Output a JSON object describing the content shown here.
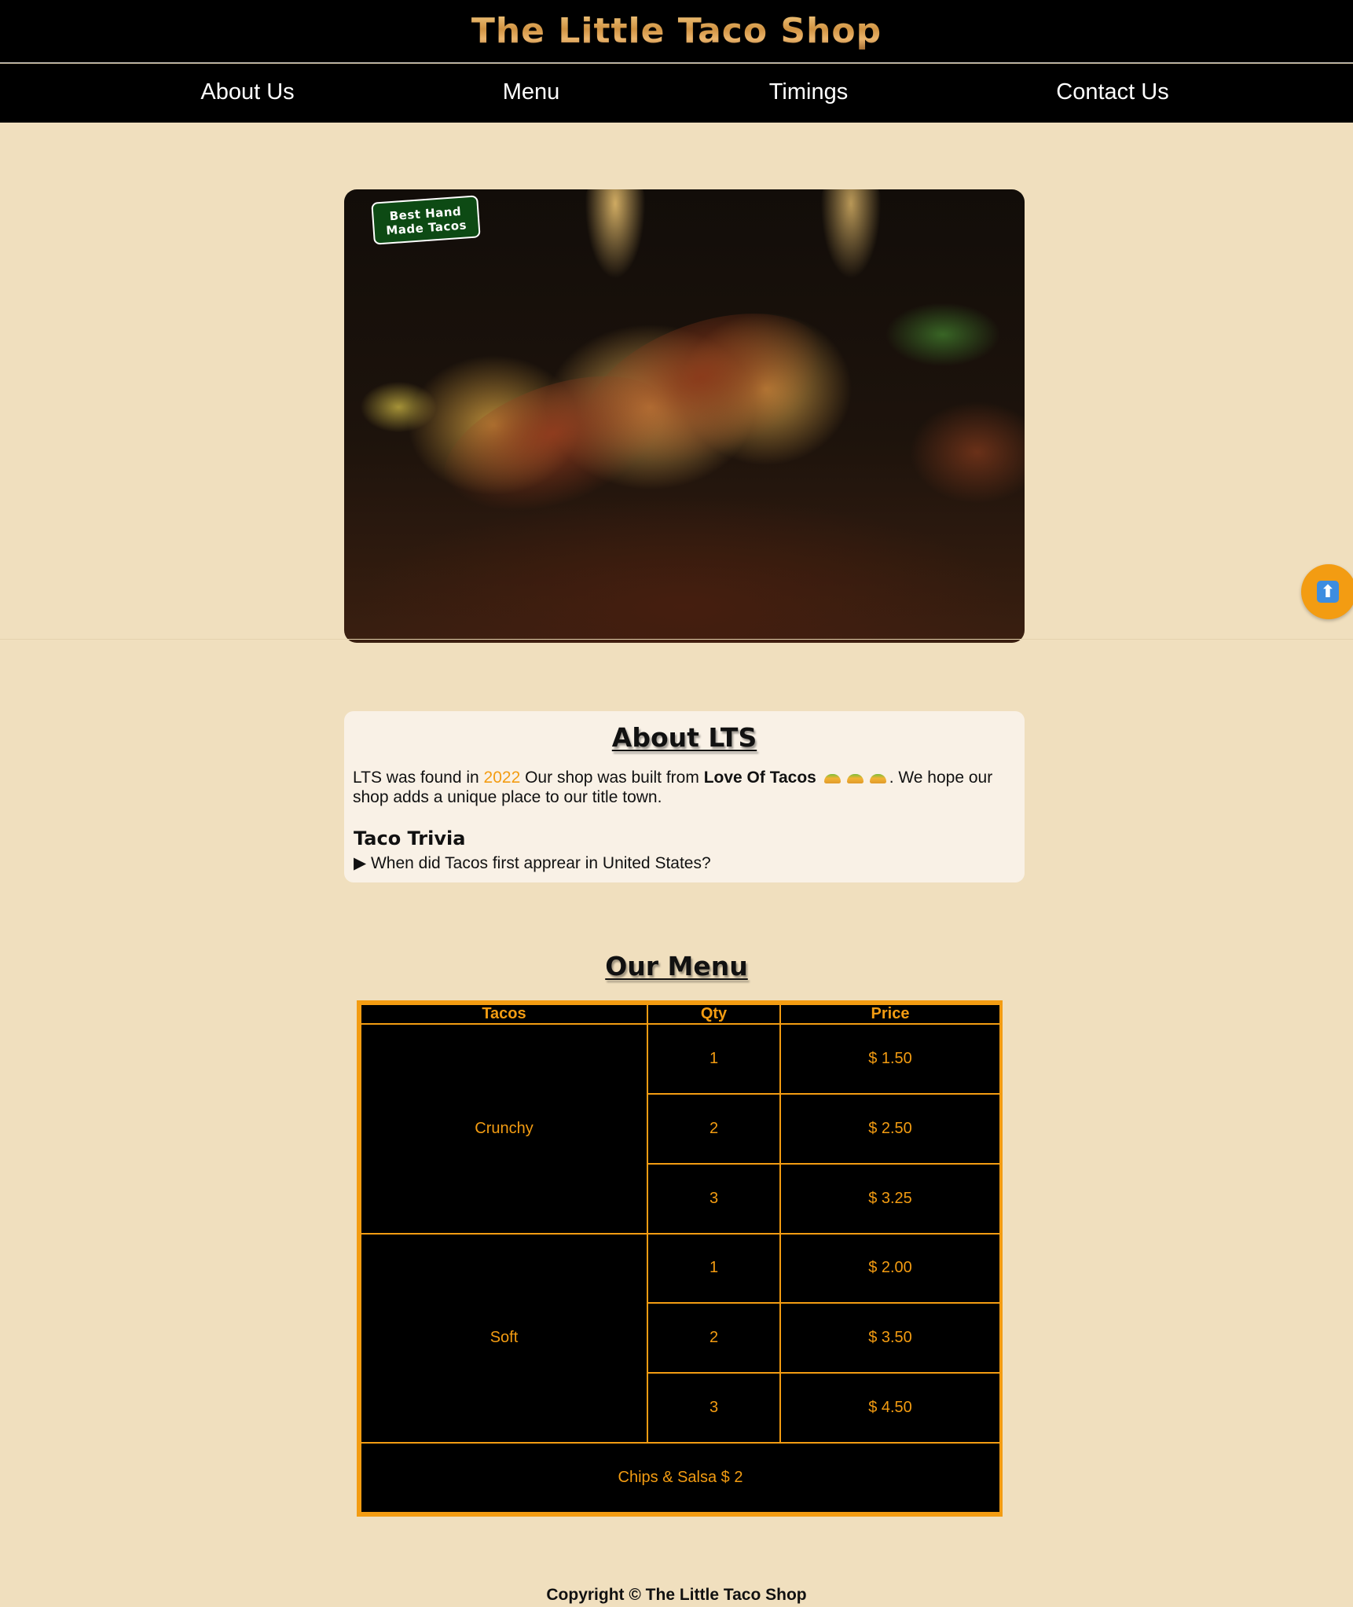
{
  "header": {
    "title": "The Little Taco Shop"
  },
  "nav": {
    "items": [
      {
        "label": "About Us"
      },
      {
        "label": "Menu"
      },
      {
        "label": "Timings"
      },
      {
        "label": "Contact Us"
      }
    ]
  },
  "hero": {
    "badge_line1": "Best Hand",
    "badge_line2": "Made Tacos"
  },
  "scroll_top": {
    "icon": "arrow-up-icon",
    "glyph": "⬆"
  },
  "about": {
    "heading": "About LTS",
    "text_1": "LTS was found in ",
    "year": "2022",
    "text_2": " Our shop was built from ",
    "bold": "Love Of Tacos",
    "text_3": ". We hope our shop adds a unique place to our title town.",
    "trivia_title": "Taco Trivia",
    "trivia_question": "▶ When did Tacos first apprear in United States?"
  },
  "menu": {
    "heading": "Our Menu",
    "columns": [
      "Tacos",
      "Qty",
      "Price"
    ],
    "groups": [
      {
        "name": "Crunchy",
        "rows": [
          {
            "qty": "1",
            "price": "$ 1.50"
          },
          {
            "qty": "2",
            "price": "$ 2.50"
          },
          {
            "qty": "3",
            "price": "$ 3.25"
          }
        ]
      },
      {
        "name": "Soft",
        "rows": [
          {
            "qty": "1",
            "price": "$ 2.00"
          },
          {
            "qty": "2",
            "price": "$ 3.50"
          },
          {
            "qty": "3",
            "price": "$ 4.50"
          }
        ]
      }
    ],
    "footer_row": "Chips & Salsa $ 2"
  },
  "footer": {
    "copyright": "Copyright © The Little Taco Shop"
  },
  "colors": {
    "accent": "#f39c12",
    "background": "#f0dfbe",
    "badge": "#0d4a14"
  }
}
